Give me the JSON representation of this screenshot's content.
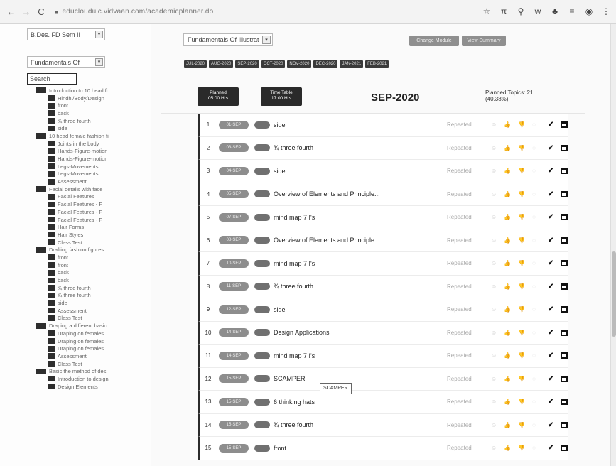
{
  "browser": {
    "back": "←",
    "forward": "→",
    "reload": "C",
    "url": "educlouduic.vidvaan.com/academicplanner.do",
    "actions": [
      "☆",
      "π",
      "⚲",
      "w",
      "♣",
      "≡",
      "◉",
      "⋮"
    ]
  },
  "sidebar": {
    "program_select": "B.Des. FD Sem II",
    "course_select": "Fundamentals Of",
    "search_placeholder": "Search",
    "tree": [
      {
        "level": 0,
        "label": "Introduction to 10 head fi"
      },
      {
        "level": 1,
        "label": "Hindhi/Body/Design"
      },
      {
        "level": 1,
        "label": "front"
      },
      {
        "level": 1,
        "label": "back"
      },
      {
        "level": 1,
        "label": "¾ three fourth"
      },
      {
        "level": 1,
        "label": "side"
      },
      {
        "level": 0,
        "label": "10 head female fashion fi"
      },
      {
        "level": 1,
        "label": "Joints in the body"
      },
      {
        "level": 1,
        "label": "Hands-Figure-motion"
      },
      {
        "level": 1,
        "label": "Hands-Figure-motion"
      },
      {
        "level": 1,
        "label": "Legs-Movements"
      },
      {
        "level": 1,
        "label": "Legs-Movements"
      },
      {
        "level": 1,
        "label": "Assessment"
      },
      {
        "level": 0,
        "label": "Facial details with face"
      },
      {
        "level": 1,
        "label": "Facial Features"
      },
      {
        "level": 1,
        "label": "Facial Features - F"
      },
      {
        "level": 1,
        "label": "Facial Features - F"
      },
      {
        "level": 1,
        "label": "Facial Features - F"
      },
      {
        "level": 1,
        "label": "Hair Forms"
      },
      {
        "level": 1,
        "label": "Hair Styles"
      },
      {
        "level": 1,
        "label": "Class Test"
      },
      {
        "level": 0,
        "label": "Drafting fashion figures"
      },
      {
        "level": 1,
        "label": "front"
      },
      {
        "level": 1,
        "label": "front"
      },
      {
        "level": 1,
        "label": "back"
      },
      {
        "level": 1,
        "label": "back"
      },
      {
        "level": 1,
        "label": "¾ three fourth"
      },
      {
        "level": 1,
        "label": "¾ three fourth"
      },
      {
        "level": 1,
        "label": "side"
      },
      {
        "level": 1,
        "label": "Assessment"
      },
      {
        "level": 1,
        "label": "Class Test"
      },
      {
        "level": 0,
        "label": "Draping a different basic"
      },
      {
        "level": 1,
        "label": "Draping on females"
      },
      {
        "level": 1,
        "label": "Draping on females"
      },
      {
        "level": 1,
        "label": "Draping on females"
      },
      {
        "level": 1,
        "label": "Assessment"
      },
      {
        "level": 1,
        "label": "Class Test"
      },
      {
        "level": 0,
        "label": "Basic the method of desi"
      },
      {
        "level": 1,
        "label": "Introduction to design"
      },
      {
        "level": 1,
        "label": "Design Elements"
      }
    ]
  },
  "main": {
    "subject_select": "Fundamentals Of Illustrat",
    "buttons": {
      "change_module": "Change Module",
      "view_summary": "View Summary"
    },
    "months": [
      "JUL-2020",
      "AUG-2020",
      "SEP-2020",
      "OCT-2020",
      "NOV-2020",
      "DEC-2020",
      "JAN-2021",
      "FEB-2021"
    ],
    "stats": {
      "planned_label": "Planned",
      "planned_value": "05:00 Hrs",
      "timetable_label": "Time Table",
      "timetable_value": "17:00 Hrs"
    },
    "month_title": "SEP-2020",
    "planned_topics": "Planned Topics: 21",
    "planned_pct": "(40.38%)",
    "tooltip": "SCAMPER",
    "rows": [
      {
        "num": "1",
        "date": "01-SEP",
        "topic": "side",
        "status": "Repeated"
      },
      {
        "num": "2",
        "date": "03-SEP",
        "topic": "¾ three fourth",
        "status": "Repeated"
      },
      {
        "num": "3",
        "date": "04-SEP",
        "topic": "side",
        "status": "Repeated"
      },
      {
        "num": "4",
        "date": "05-SEP",
        "topic": "Overview of Elements and Principle...",
        "status": "Repeated"
      },
      {
        "num": "5",
        "date": "07-SEP",
        "topic": "mind map 7 I's",
        "status": "Repeated"
      },
      {
        "num": "6",
        "date": "08-SEP",
        "topic": "Overview of Elements and Principle...",
        "status": "Repeated"
      },
      {
        "num": "7",
        "date": "10-SEP",
        "topic": "mind map 7 I's",
        "status": "Repeated"
      },
      {
        "num": "8",
        "date": "11-SEP",
        "topic": "¾ three fourth",
        "status": "Repeated"
      },
      {
        "num": "9",
        "date": "12-SEP",
        "topic": "side",
        "status": "Repeated"
      },
      {
        "num": "10",
        "date": "14-SEP",
        "topic": "Design Applications",
        "status": "Repeated"
      },
      {
        "num": "11",
        "date": "14-SEP",
        "topic": "mind map 7 I's",
        "status": "Repeated"
      },
      {
        "num": "12",
        "date": "15-SEP",
        "topic": "SCAMPER",
        "status": "Repeated"
      },
      {
        "num": "13",
        "date": "15-SEP",
        "topic": "6 thinking hats",
        "status": "Repeated"
      },
      {
        "num": "14",
        "date": "15-SEP",
        "topic": "¾ three fourth",
        "status": "Repeated"
      },
      {
        "num": "15",
        "date": "15-SEP",
        "topic": "front",
        "status": "Repeated"
      }
    ],
    "row_icons": [
      "☺",
      "👍",
      "👎",
      "◌"
    ],
    "check_glyph": "✔"
  }
}
